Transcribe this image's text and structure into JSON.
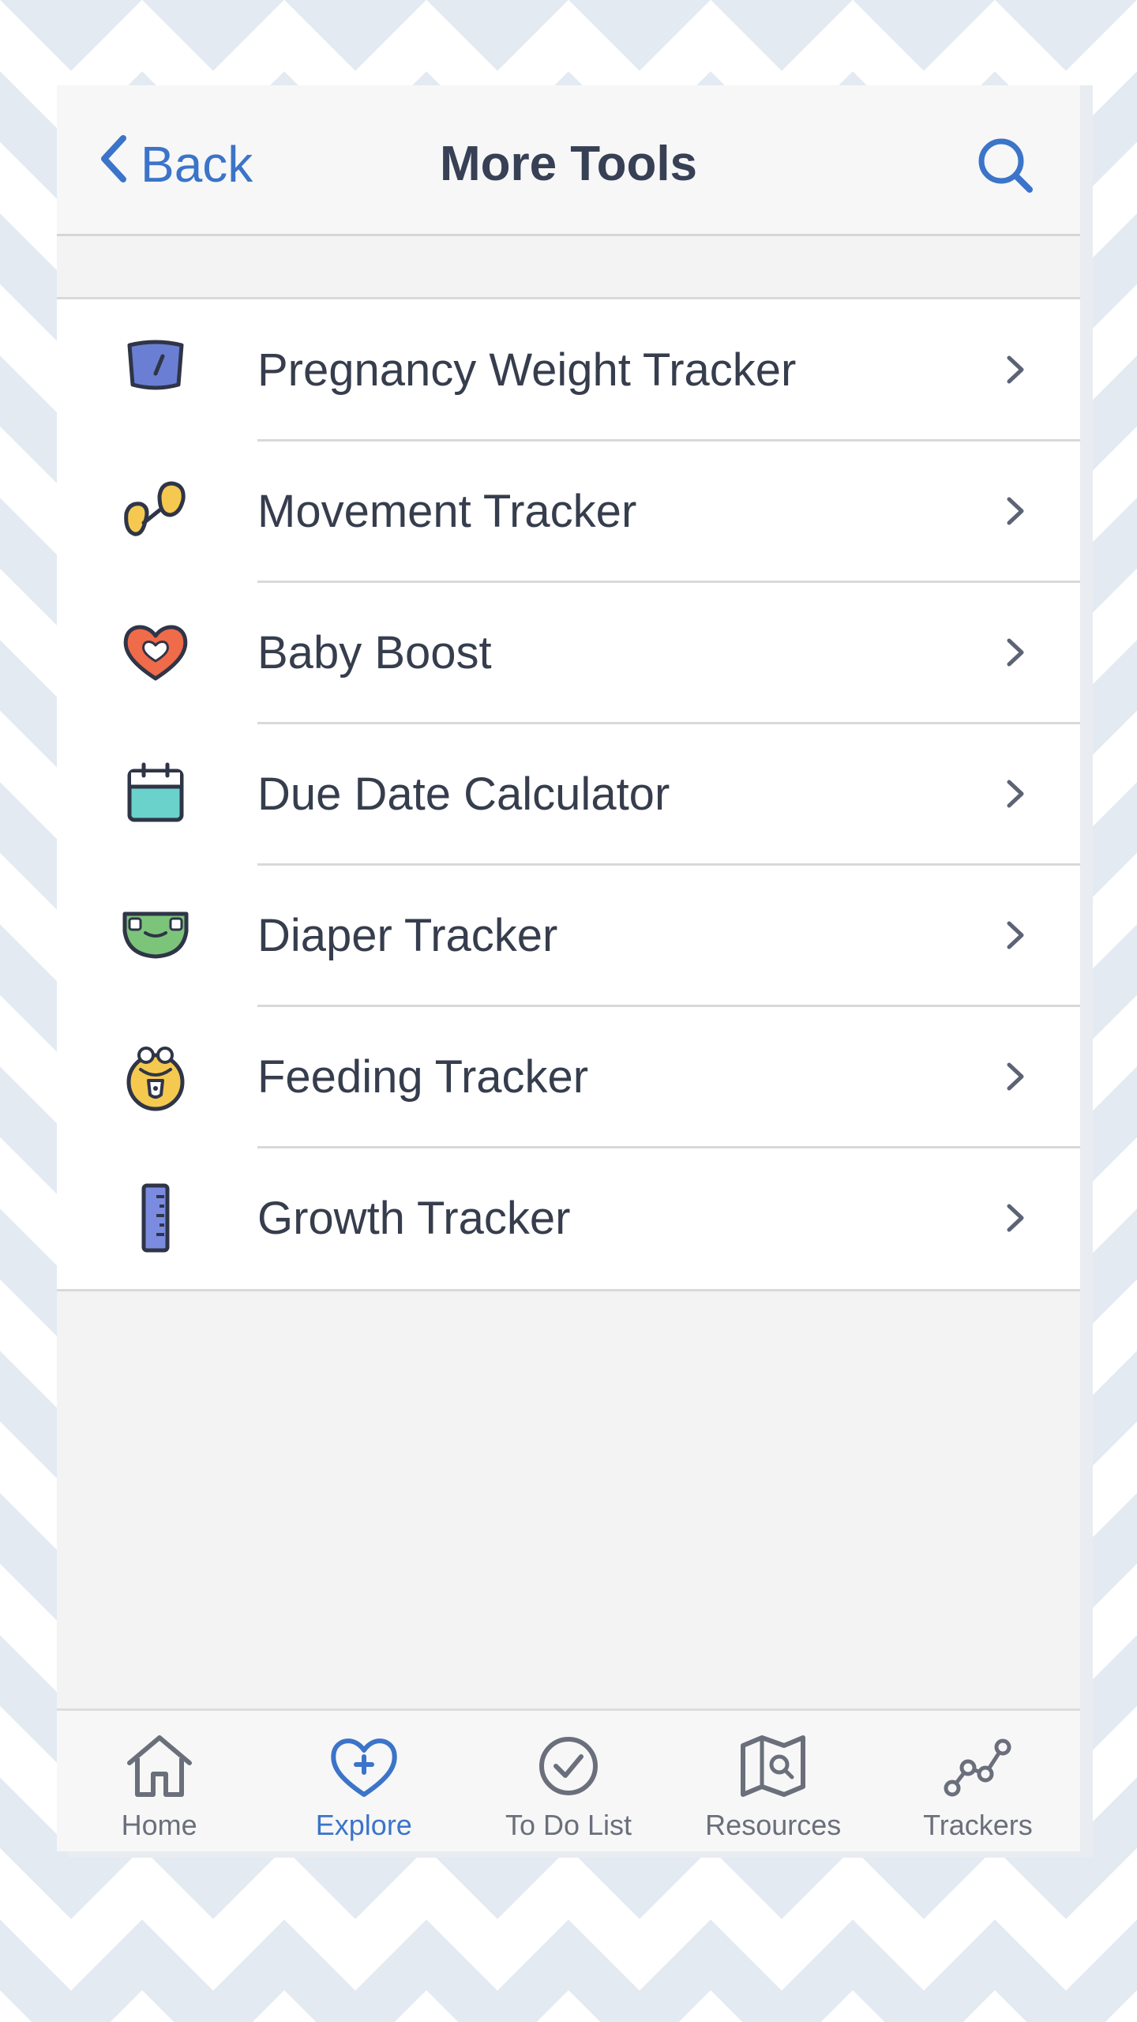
{
  "header": {
    "back_label": "Back",
    "title": "More Tools",
    "search_icon": "search-icon",
    "back_icon": "chevron-left-icon",
    "accent_color": "#3b74c9"
  },
  "tools": [
    {
      "label": "Pregnancy Weight Tracker",
      "icon": "scale-icon"
    },
    {
      "label": "Movement Tracker",
      "icon": "baby-feet-icon"
    },
    {
      "label": "Baby Boost",
      "icon": "heart-icon"
    },
    {
      "label": "Due Date Calculator",
      "icon": "calendar-icon"
    },
    {
      "label": "Diaper Tracker",
      "icon": "diaper-icon"
    },
    {
      "label": "Feeding Tracker",
      "icon": "baby-bib-icon"
    },
    {
      "label": "Growth Tracker",
      "icon": "ruler-icon"
    }
  ],
  "tabbar": {
    "active": "Explore",
    "tabs": [
      {
        "label": "Home",
        "icon": "home-icon"
      },
      {
        "label": "Explore",
        "icon": "heart-plus-icon"
      },
      {
        "label": "To Do List",
        "icon": "check-circle-icon"
      },
      {
        "label": "Resources",
        "icon": "map-search-icon"
      },
      {
        "label": "Trackers",
        "icon": "trend-line-icon"
      }
    ]
  }
}
